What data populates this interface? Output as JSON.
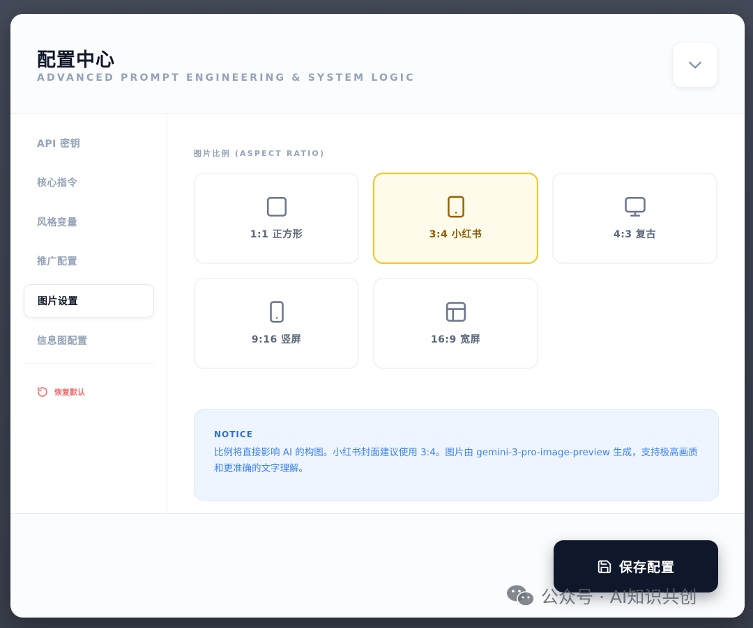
{
  "header": {
    "title": "配置中心",
    "subtitle": "ADVANCED PROMPT ENGINEERING & SYSTEM LOGIC",
    "collapse_icon": "chevron-down-icon"
  },
  "sidebar": {
    "items": [
      {
        "label": "API 密钥",
        "active": false
      },
      {
        "label": "核心指令",
        "active": false
      },
      {
        "label": "风格变量",
        "active": false
      },
      {
        "label": "推广配置",
        "active": false
      },
      {
        "label": "图片设置",
        "active": true
      },
      {
        "label": "信息图配置",
        "active": false
      }
    ],
    "reset_label": "恢复默认",
    "reset_color": "#f26b6b"
  },
  "main": {
    "section_label": "图片比例 (ASPECT RATIO)",
    "ratios": [
      {
        "label": "1:1 正方形",
        "icon": "square-icon",
        "selected": false
      },
      {
        "label": "3:4 小红书",
        "icon": "tablet-icon",
        "selected": true
      },
      {
        "label": "4:3 复古",
        "icon": "monitor-icon",
        "selected": false
      },
      {
        "label": "9:16 竖屏",
        "icon": "phone-icon",
        "selected": false
      },
      {
        "label": "16:9 宽屏",
        "icon": "layout-icon",
        "selected": false
      }
    ],
    "notice": {
      "title": "NOTICE",
      "body": "比例将直接影响 AI 的构图。小红书封面建议使用 3:4。图片由 gemini-3-pro-image-preview 生成，支持极高画质和更准确的文字理解。"
    }
  },
  "footer": {
    "save_label": "保存配置",
    "save_icon": "save-icon"
  },
  "watermark": {
    "text": "公众号 · AI知识共创"
  },
  "colors": {
    "accent_selected_border": "#f5c518",
    "accent_selected_bg": "#fffbea",
    "primary_dark": "#0f172a",
    "notice_text": "#3b82f6"
  }
}
